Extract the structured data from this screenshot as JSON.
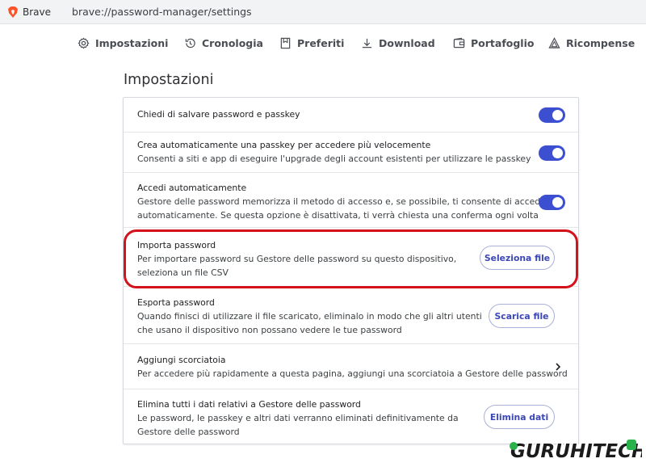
{
  "browser": {
    "name": "Brave",
    "url": "brave://password-manager/settings"
  },
  "nav": [
    {
      "label": "Impostazioni",
      "icon": "gear-icon"
    },
    {
      "label": "Cronologia",
      "icon": "history-icon"
    },
    {
      "label": "Preferiti",
      "icon": "bookmark-icon"
    },
    {
      "label": "Download",
      "icon": "download-icon"
    },
    {
      "label": "Portafoglio",
      "icon": "wallet-icon"
    },
    {
      "label": "Ricompense",
      "icon": "rewards-icon"
    }
  ],
  "page": {
    "title": "Impostazioni"
  },
  "settings": {
    "save_passwords": {
      "title": "Chiedi di salvare password e passkey",
      "enabled": true
    },
    "auto_passkey": {
      "title": "Crea automaticamente una passkey per accedere più velocemente",
      "desc": "Consenti a siti e app di eseguire l'upgrade degli account esistenti per utilizzare le passkey",
      "enabled": true
    },
    "auto_signin": {
      "title": "Accedi automaticamente",
      "desc1": "Gestore delle password memorizza il metodo di accesso e, se possibile, ti consente di accedere",
      "desc2": "automaticamente. Se questa opzione è disattivata, ti verrà chiesta una conferma ogni volta",
      "enabled": true
    },
    "import": {
      "title": "Importa password",
      "desc1": "Per importare password su Gestore delle password su questo dispositivo,",
      "desc2": "seleziona un file CSV",
      "button": "Seleziona file"
    },
    "export": {
      "title": "Esporta password",
      "desc1": "Quando finisci di utilizzare il file scaricato, eliminalo in modo che gli altri utenti",
      "desc2": "che usano il dispositivo non possano vedere le tue password",
      "button": "Scarica file"
    },
    "shortcut": {
      "title": "Aggiungi scorciatoia",
      "desc": "Per accedere più rapidamente a questa pagina, aggiungi una scorciatoia a Gestore delle password"
    },
    "delete": {
      "title": "Elimina tutti i dati relativi a Gestore delle password",
      "desc1": "Le password, le passkey e altri dati verranno eliminati definitivamente da",
      "desc2": "Gestore delle password",
      "button": "Elimina dati"
    }
  },
  "colors": {
    "accent": "#3c4fd1",
    "button_text": "#3b47b5",
    "highlight": "#d3121b",
    "watermark": "#111111"
  },
  "watermark": {
    "text": "GURUHITECH"
  }
}
